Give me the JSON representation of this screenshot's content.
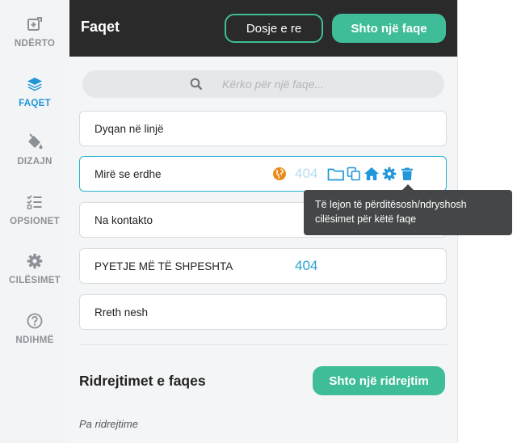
{
  "rail": {
    "items": [
      {
        "label": "NDËRTO",
        "icon": "plus-square-icon",
        "active": false
      },
      {
        "label": "FAQET",
        "icon": "layers-icon",
        "active": true
      },
      {
        "label": "DIZAJN",
        "icon": "paint-bucket-icon",
        "active": false
      },
      {
        "label": "OPSIONET",
        "icon": "checklist-icon",
        "active": false
      },
      {
        "label": "CILËSIMET",
        "icon": "gear-icon",
        "active": false
      },
      {
        "label": "NDIHMË",
        "icon": "help-circle-icon",
        "active": false
      }
    ]
  },
  "header": {
    "title": "Faqet",
    "new_folder_label": "Dosje e re",
    "add_page_label": "Shto një faqe"
  },
  "search": {
    "placeholder": "Kërko për një faqe..."
  },
  "pages": [
    {
      "name": "Dyqan në linjë",
      "code": ""
    },
    {
      "name": "Mirë se erdhe",
      "code": "404"
    },
    {
      "name": "Na kontakto",
      "code": ""
    },
    {
      "name": "PYETJE MË TË SHPESHTA",
      "code": "404"
    },
    {
      "name": "Rreth nesh",
      "code": ""
    }
  ],
  "tooltip": {
    "text": "Të lejon të përditësosh/ndryshosh cilësimet për këtë faqe"
  },
  "redirects": {
    "title": "Ridrejtimet e faqes",
    "add_label": "Shto një ridrejtim",
    "empty_note": "Pa ridrejtime"
  },
  "colors": {
    "accent": "#3fbd98",
    "active_blue": "#2196d9",
    "header_bg": "#2a2a2a",
    "globe_orange": "#e98a1a"
  }
}
